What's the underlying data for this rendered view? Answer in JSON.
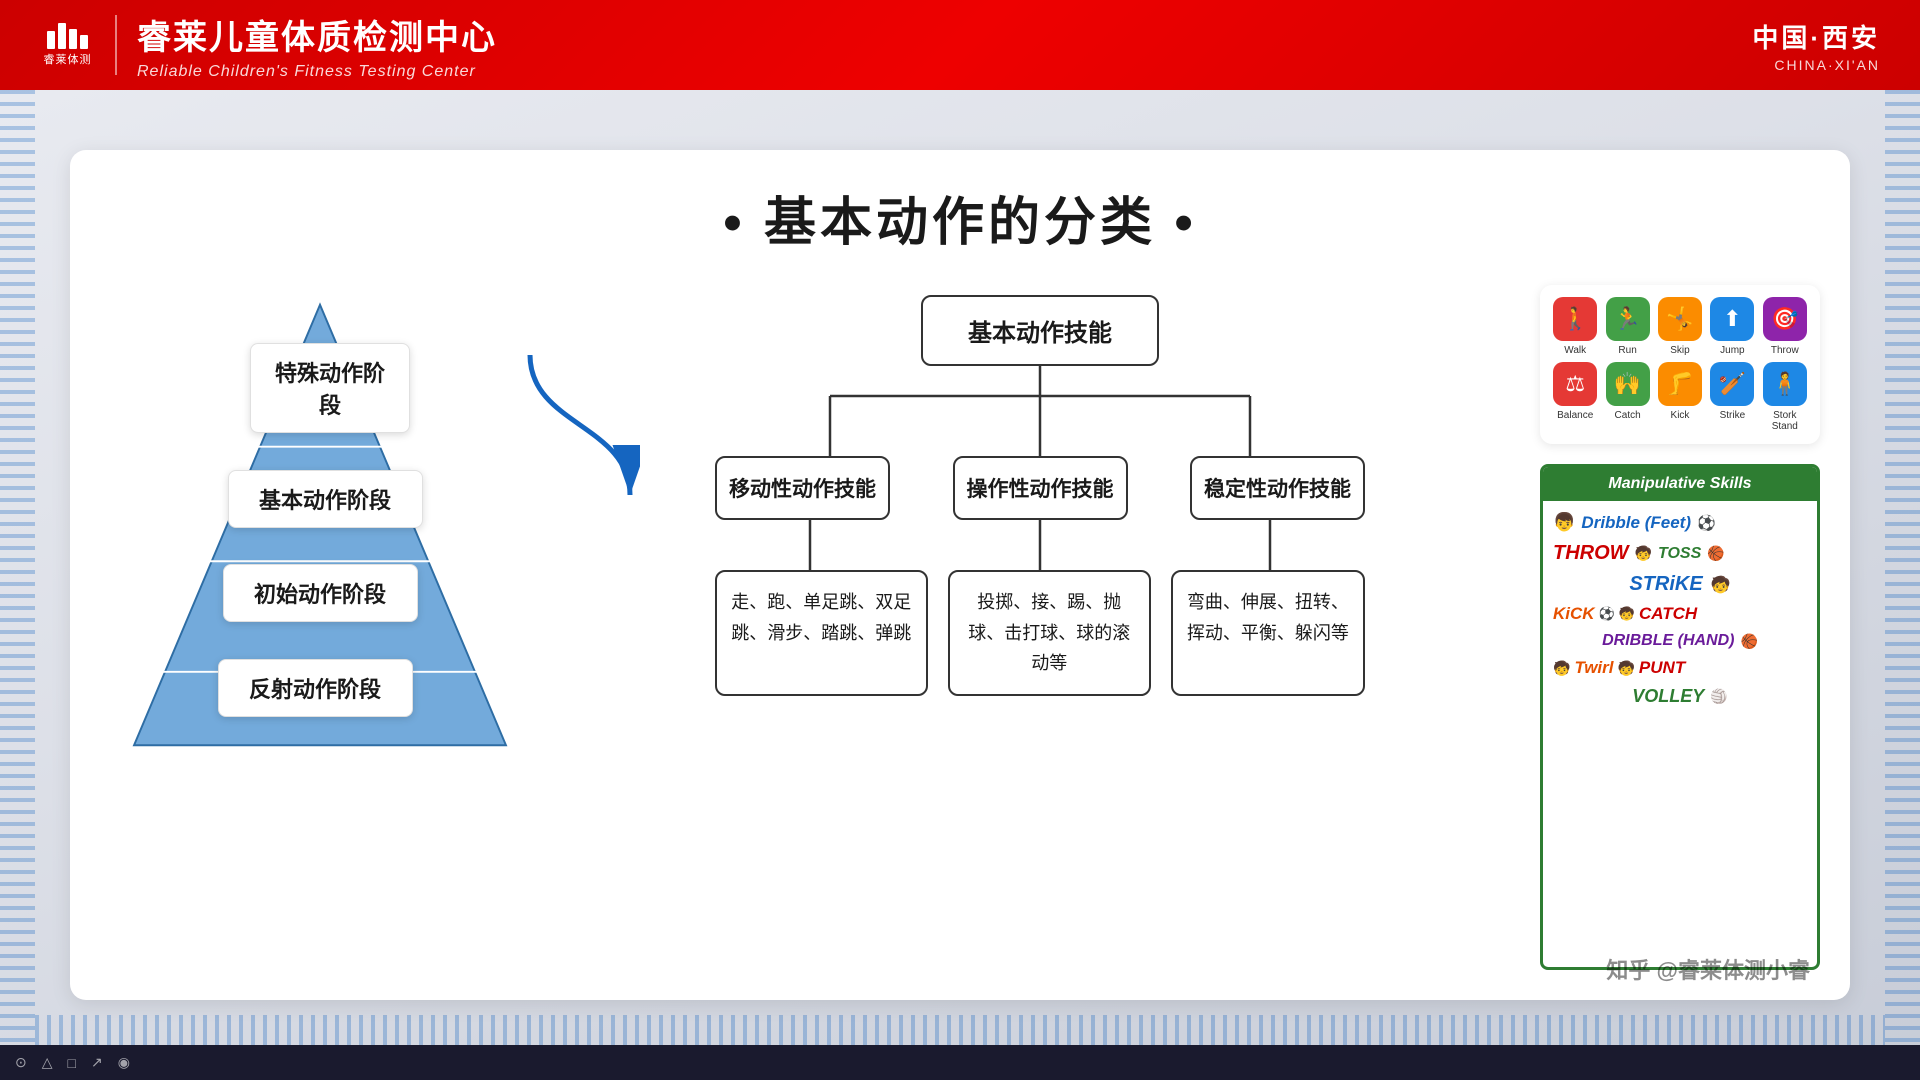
{
  "header": {
    "logo_text": "睿莱体测",
    "title_cn": "睿莱儿童体质检测中心",
    "title_en": "Reliable Children's Fitness Testing Center",
    "location_cn": "中国·西安",
    "location_en": "CHINA·XI'AN"
  },
  "page": {
    "title": "• 基本动作的分类 •"
  },
  "pyramid": {
    "levels": [
      {
        "label": "特殊动作阶段",
        "id": "special"
      },
      {
        "label": "基本动作阶段",
        "id": "basic"
      },
      {
        "label": "初始动作阶段",
        "id": "initial"
      },
      {
        "label": "反射动作阶段",
        "id": "reflex"
      }
    ]
  },
  "flowchart": {
    "root": "基本动作技能",
    "branches": [
      {
        "label": "移动性动作技能",
        "detail": "走、跑、单足跳、双足跳、滑步、踏跳、弹跳"
      },
      {
        "label": "操作性动作技能",
        "detail": "投掷、接、踢、抛球、击打球、球的滚动等"
      },
      {
        "label": "稳定性动作技能",
        "detail": "弯曲、伸展、扭转、挥动、平衡、躲闪等"
      }
    ]
  },
  "icons": {
    "row1": [
      {
        "label": "Walk",
        "color": "#e53935",
        "glyph": "🚶"
      },
      {
        "label": "Run",
        "color": "#43a047",
        "glyph": "🏃"
      },
      {
        "label": "Skip",
        "color": "#fb8c00",
        "glyph": "🤸"
      },
      {
        "label": "Jump",
        "color": "#1e88e5",
        "glyph": "⬆"
      },
      {
        "label": "Throw",
        "color": "#8e24aa",
        "glyph": "🎯"
      }
    ],
    "row2": [
      {
        "label": "Balance",
        "color": "#e53935",
        "glyph": "⚖"
      },
      {
        "label": "Catch",
        "color": "#43a047",
        "glyph": "🙌"
      },
      {
        "label": "Kick",
        "color": "#fb8c00",
        "glyph": "🦵"
      },
      {
        "label": "Strike",
        "color": "#1e88e5",
        "glyph": "🏏"
      },
      {
        "label": "Stork Stand",
        "color": "#1e88e5",
        "glyph": "🧍"
      }
    ]
  },
  "manip_skills": {
    "header": "Manipulative Skills",
    "skills": [
      {
        "name": "Dribble (Feet)",
        "color": "blue"
      },
      {
        "name": "THROW",
        "color": "red"
      },
      {
        "name": "TOSS",
        "color": "green"
      },
      {
        "name": "STRiKE",
        "color": "blue"
      },
      {
        "name": "KiCK",
        "color": "orange"
      },
      {
        "name": "CATCH",
        "color": "red"
      },
      {
        "name": "DRIBBLE (HAND)",
        "color": "purple"
      },
      {
        "name": "Twirl",
        "color": "orange"
      },
      {
        "name": "PUNT",
        "color": "red"
      },
      {
        "name": "VOLLEY",
        "color": "green"
      }
    ]
  },
  "watermark": "知乎 @睿莱体测小睿"
}
